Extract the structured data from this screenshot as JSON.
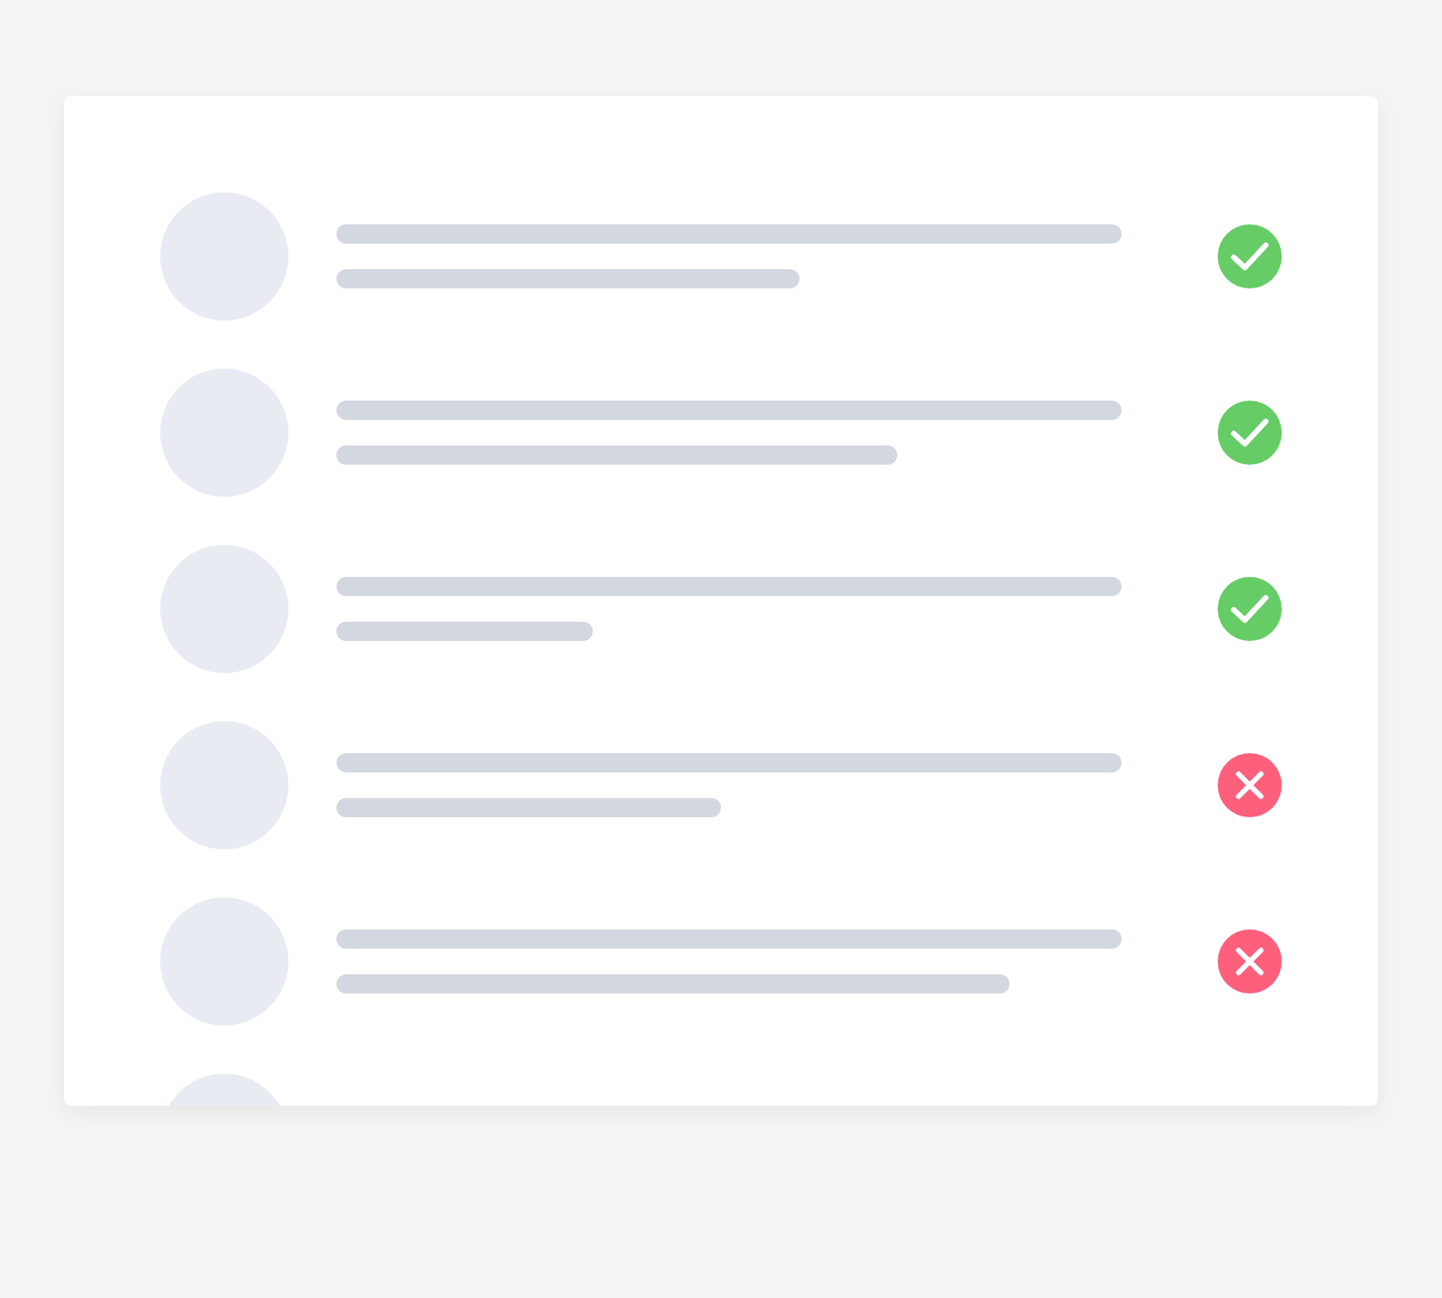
{
  "rows": [
    {
      "kind": "approved"
    },
    {
      "kind": "approved"
    },
    {
      "kind": "approved"
    },
    {
      "kind": "rejected"
    },
    {
      "kind": "rejected"
    },
    {
      "kind": "cutoff"
    }
  ]
}
